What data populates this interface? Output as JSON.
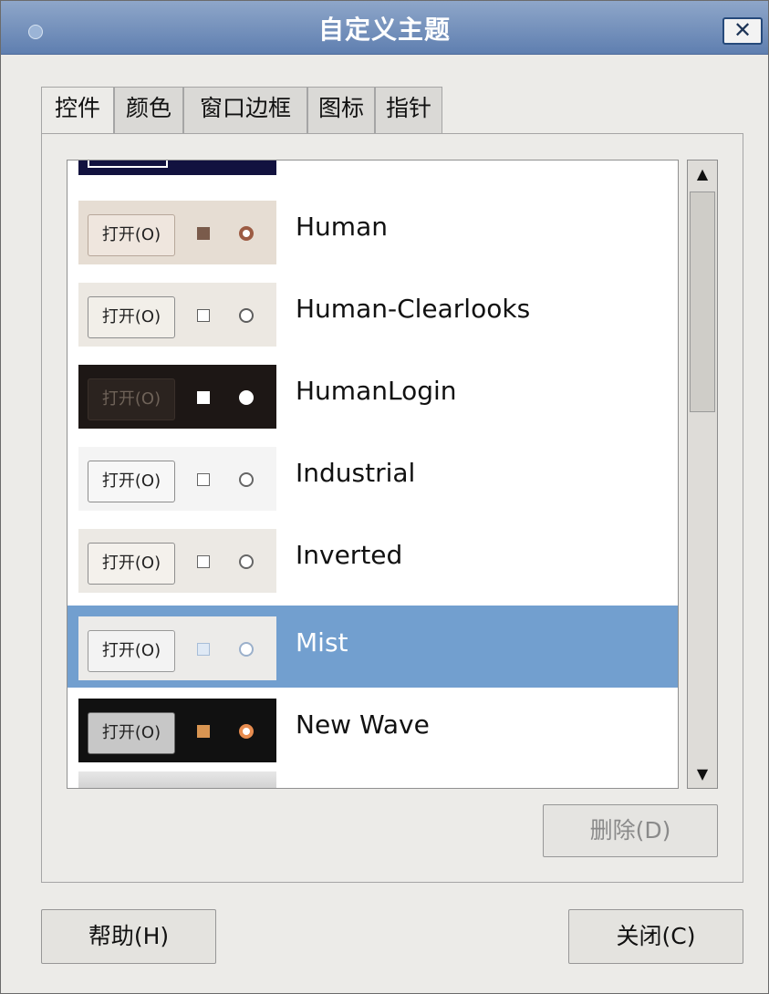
{
  "window": {
    "title": "自定义主题",
    "close_glyph": "✕"
  },
  "tabs": [
    {
      "label": "控件"
    },
    {
      "label": "颜色"
    },
    {
      "label": "窗口边框"
    },
    {
      "label": "图标"
    },
    {
      "label": "指针"
    }
  ],
  "themes": {
    "items": [
      {
        "name": "Human",
        "button": "打开(O)"
      },
      {
        "name": "Human-Clearlooks",
        "button": "打开(O)"
      },
      {
        "name": "HumanLogin",
        "button": "打开(O)"
      },
      {
        "name": "Industrial",
        "button": "打开(O)"
      },
      {
        "name": "Inverted",
        "button": "打开(O)"
      },
      {
        "name": "Mist",
        "button": "打开(O)"
      },
      {
        "name": "New Wave",
        "button": "打开(O)"
      }
    ],
    "selected": "Mist"
  },
  "scrollbar": {
    "up_glyph": "▲",
    "down_glyph": "▼"
  },
  "buttons": {
    "delete": "删除(D)",
    "help": "帮助(H)",
    "close": "关闭(C)"
  },
  "colors": {
    "titlebar": "#6f8fbf",
    "selection": "#729fcf"
  }
}
